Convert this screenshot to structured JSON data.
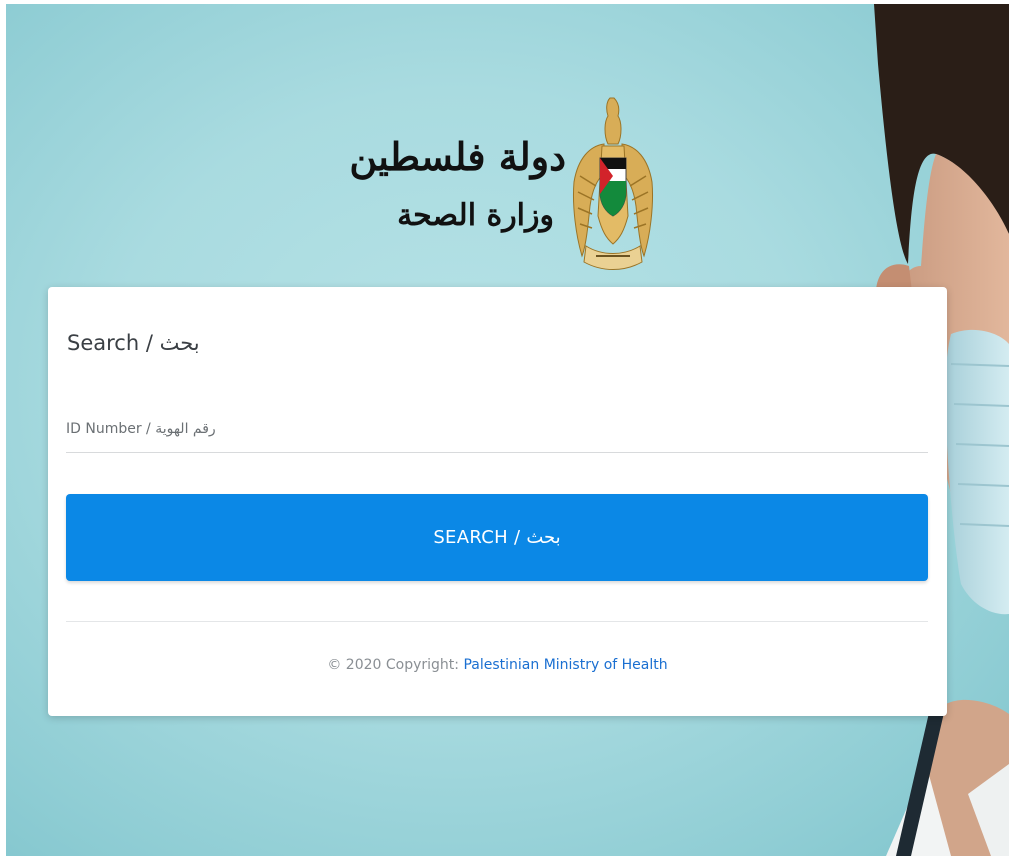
{
  "header": {
    "title": "دولة فلسطين",
    "subtitle": "وزارة الصحة",
    "emblem_icon": "palestine-eagle-emblem-icon"
  },
  "form": {
    "title": "Search / بحث",
    "id_placeholder": "ID Number / رقم الهوية",
    "id_value": "",
    "button_label": "SEARCH / بحث"
  },
  "footer": {
    "copyright_text": "© 2020 Copyright: ",
    "link_text": "Palestinian Ministry of Health"
  },
  "colors": {
    "background": "#a9dbe0",
    "button": "#0b88e6",
    "link": "#1a6fd1"
  }
}
